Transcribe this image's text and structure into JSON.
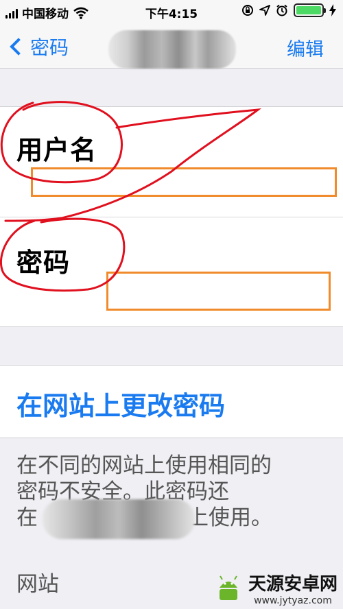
{
  "status_bar": {
    "carrier": "中国移动",
    "time": "下午4:15",
    "battery_color": "#4cd964"
  },
  "nav": {
    "back_label": "密码",
    "edit_label": "编辑"
  },
  "fields": {
    "username_label": "用户名",
    "password_label": "密码"
  },
  "change_password_link": "在网站上更改密码",
  "warning": {
    "line1": "在不同的网站上使用相同的",
    "line2": "密码不安全。此密码还",
    "line3_start": "在",
    "line3_end": "上使用。"
  },
  "section_header": "网站",
  "watermark": {
    "title": "天源安卓网",
    "url": "www.jytyaz.com"
  },
  "colors": {
    "accent": "#1a7bf0",
    "highlight_box": "#f08a2a",
    "annotation": "#e0101e"
  }
}
